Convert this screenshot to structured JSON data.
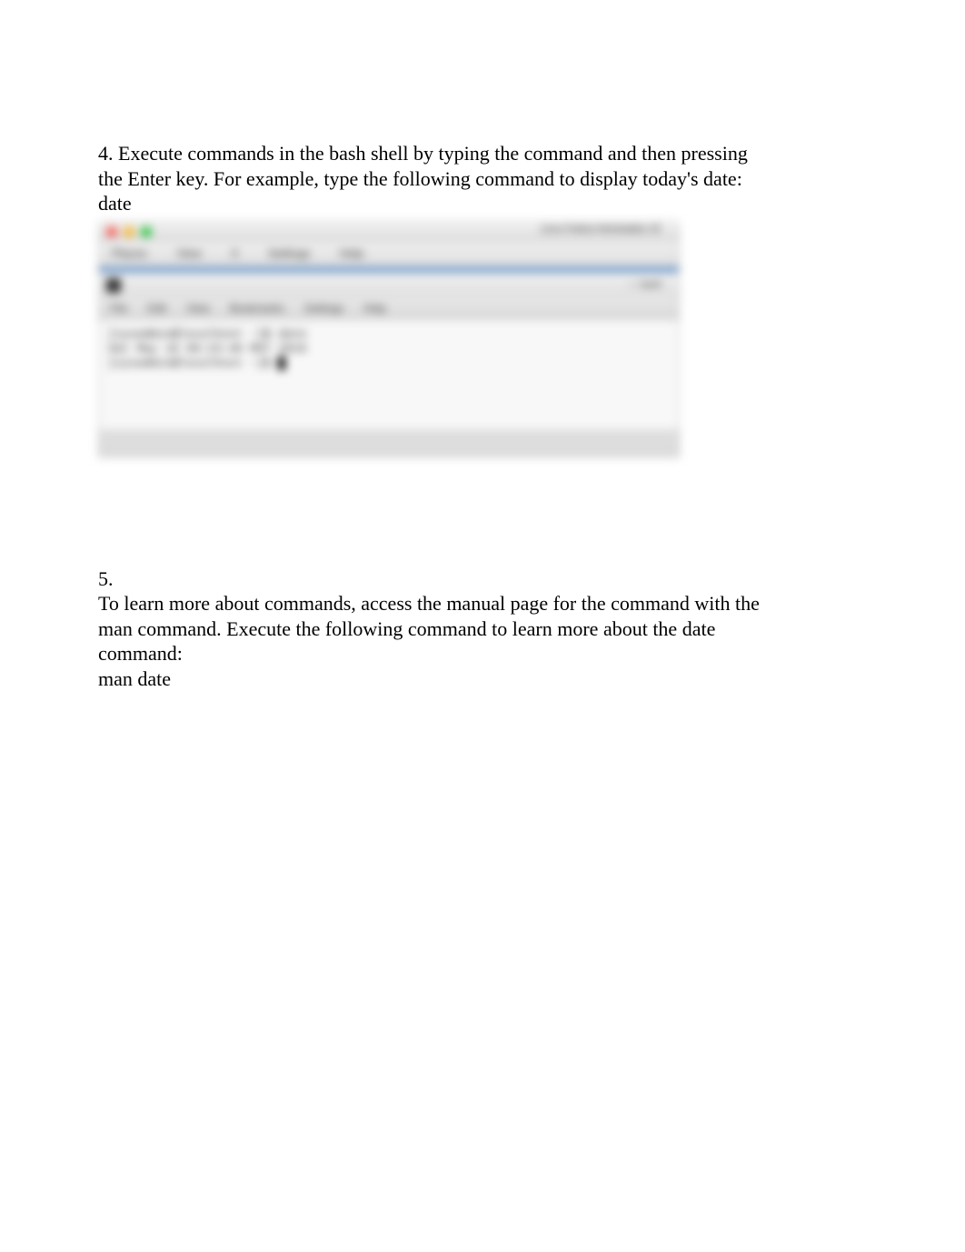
{
  "step4": {
    "number_and_text1": "4. Execute commands in the bash shell by typing the command and then pressing",
    "text2": "the Enter key. For example, type the following command to display today's date:",
    "command": "date"
  },
  "screenshot": {
    "outer_title": "Linux Fedora Workstation 25",
    "outer_menu": [
      "Places",
      "View",
      "X",
      "Settings",
      "Help"
    ],
    "inner_title_right": "— bash",
    "inner_menu": [
      "File",
      "Edit",
      "View",
      "Bookmarks",
      "Settings",
      "Help"
    ],
    "terminal": {
      "line1": "[sysadmin@localhost ~]$ date",
      "line2": "Sat May 18 09:23:46 MST 2019",
      "line3_prompt": "[sysadmin@localhost ~]$ "
    }
  },
  "step5": {
    "number": "5.",
    "text1": "To learn more about commands, access the manual page for the command with the",
    "text2": "man command. Execute the following command to learn more about the date",
    "text3": "command:",
    "command": "man date"
  }
}
